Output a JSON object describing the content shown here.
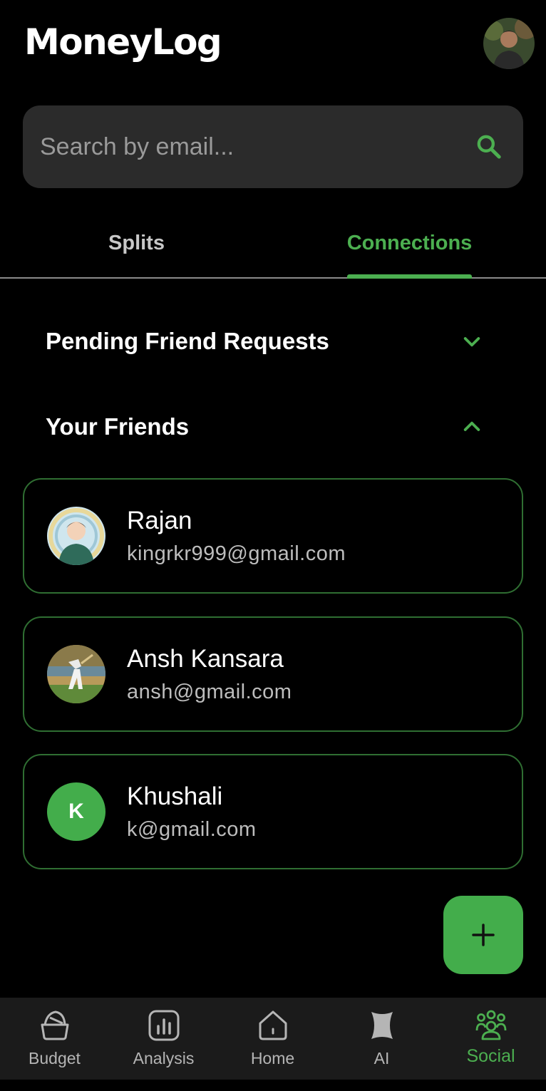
{
  "app": {
    "title": "MoneyLog"
  },
  "search": {
    "placeholder": "Search by email...",
    "value": ""
  },
  "tabs": [
    {
      "label": "Splits",
      "active": false
    },
    {
      "label": "Connections",
      "active": true
    }
  ],
  "sections": {
    "pending": {
      "title": "Pending Friend Requests",
      "expanded": false
    },
    "friends": {
      "title": "Your Friends",
      "expanded": true
    }
  },
  "friends": [
    {
      "name": "Rajan",
      "email": "kingrkr999@gmail.com",
      "avatar": "photo"
    },
    {
      "name": "Ansh Kansara",
      "email": "ansh@gmail.com",
      "avatar": "photo"
    },
    {
      "name": "Khushali",
      "email": "k@gmail.com",
      "avatar_letter": "K"
    }
  ],
  "nav": [
    {
      "label": "Budget",
      "icon": "basket-icon",
      "active": false
    },
    {
      "label": "Analysis",
      "icon": "bar-chart-icon",
      "active": false
    },
    {
      "label": "Home",
      "icon": "home-icon",
      "active": false
    },
    {
      "label": "AI",
      "icon": "ai-icon",
      "active": false
    },
    {
      "label": "Social",
      "icon": "people-icon",
      "active": true
    }
  ],
  "colors": {
    "accent": "#4caf50",
    "background": "#000000",
    "surface": "#2b2b2b",
    "nav_background": "#1b1b1b",
    "card_border": "#2f6e32"
  }
}
